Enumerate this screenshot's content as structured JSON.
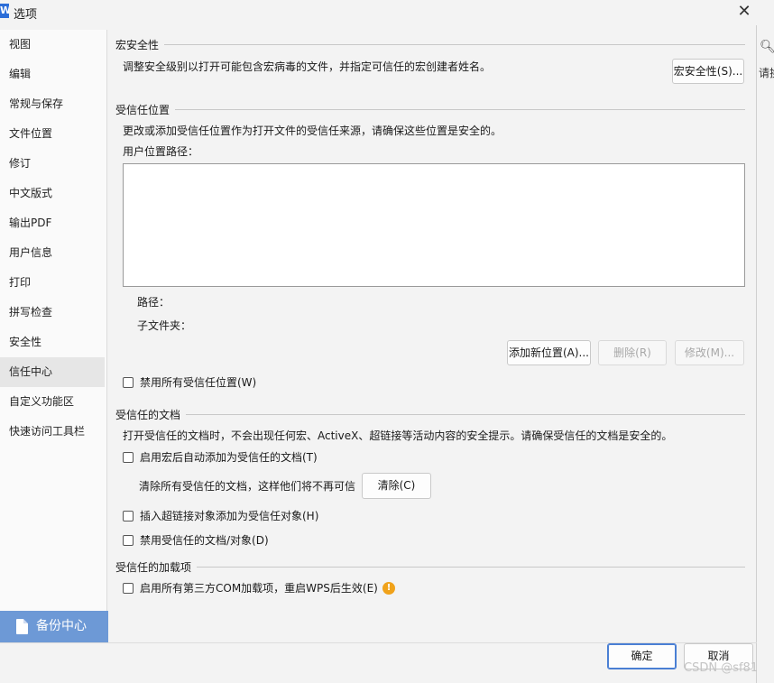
{
  "window": {
    "title": "选项",
    "app_icon": "W",
    "close_glyph": "✕"
  },
  "background_app": {
    "partial_text": "请换"
  },
  "sidebar": {
    "items": [
      {
        "label": "视图"
      },
      {
        "label": "编辑"
      },
      {
        "label": "常规与保存"
      },
      {
        "label": "文件位置"
      },
      {
        "label": "修订"
      },
      {
        "label": "中文版式"
      },
      {
        "label": "输出PDF"
      },
      {
        "label": "用户信息"
      },
      {
        "label": "打印"
      },
      {
        "label": "拼写检查"
      },
      {
        "label": "安全性"
      },
      {
        "label": "信任中心",
        "active": true
      },
      {
        "label": "自定义功能区"
      },
      {
        "label": "快速访问工具栏"
      }
    ],
    "backup_label": "备份中心"
  },
  "macro_security": {
    "heading": "宏安全性",
    "description": "调整安全级别以打开可能包含宏病毒的文件，并指定可信任的宏创建者姓名。",
    "button_label": "宏安全性(S)..."
  },
  "trusted_locations": {
    "heading": "受信任位置",
    "description": "更改或添加受信任位置作为打开文件的受信任来源，请确保这些位置是安全的。",
    "user_paths_label": "用户位置路径：",
    "path_label": "路径：",
    "subfolder_label": "子文件夹：",
    "add_button": "添加新位置(A)...",
    "delete_button": "删除(R)",
    "modify_button": "修改(M)...",
    "disable_all_label": "禁用所有受信任位置(W)",
    "disable_all_checked": false
  },
  "trusted_documents": {
    "heading": "受信任的文档",
    "description": "打开受信任的文档时，不会出现任何宏、ActiveX、超链接等活动内容的安全提示。请确保受信任的文档是安全的。",
    "auto_add_label": "启用宏后自动添加为受信任的文档(T)",
    "auto_add_checked": false,
    "clear_text": "清除所有受信任的文档，这样他们将不再可信",
    "clear_button": "清除(C)",
    "hyperlink_label": "插入超链接对象添加为受信任对象(H)",
    "hyperlink_checked": false,
    "disable_label": "禁用受信任的文档/对象(D)",
    "disable_checked": false
  },
  "trusted_addins": {
    "heading": "受信任的加载项",
    "enable_com_label": "启用所有第三方COM加载项，重启WPS后生效(E)",
    "enable_com_checked": false,
    "warn_glyph": "!"
  },
  "footer": {
    "ok_button": "确定",
    "cancel_button": "取消"
  },
  "watermark": "CSDN @sf81",
  "colors": {
    "accent": "#4a7fd4",
    "backup_bg": "#6d99d6",
    "warning": "#f0a21a",
    "app_icon_bg": "#2b6dd8"
  }
}
